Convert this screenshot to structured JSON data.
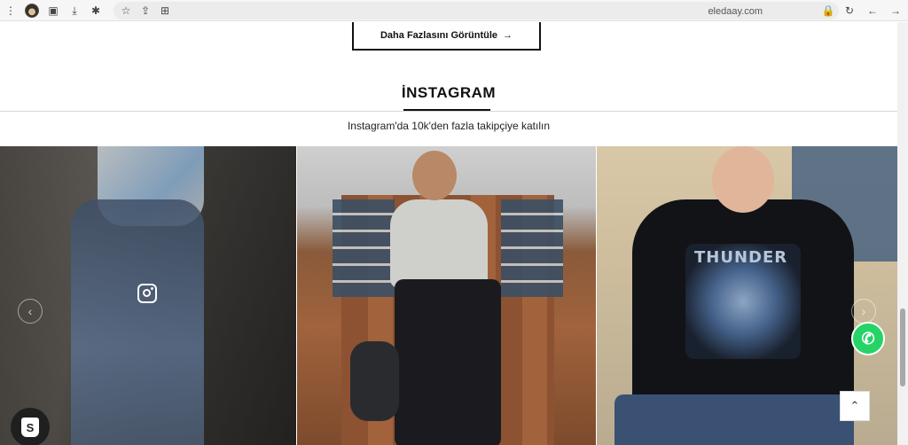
{
  "browser": {
    "url": "eledaay.com",
    "icons": [
      "menu-dots-icon",
      "avatar",
      "sidebar-icon",
      "download-icon",
      "extensions-icon",
      "star-icon",
      "share-icon",
      "translate-icon",
      "lock-icon",
      "reload-icon",
      "back-icon",
      "forward-icon"
    ]
  },
  "page": {
    "more_button": {
      "label": "Daha Fazlasını Görüntüle",
      "arrow": "→"
    },
    "instagram": {
      "title": "İNSTAGRAM",
      "subtitle": "Instagram'da 10k'den fazla takipçiye katılın",
      "tile3_print": "THUNDER"
    },
    "floating": {
      "to_top_glyph": "⌃",
      "whatsapp_glyph": "✆",
      "shopify_glyph": "S",
      "prev_glyph": "‹",
      "next_glyph": "›"
    }
  },
  "colors": {
    "whatsapp": "#25d366",
    "accent": "#111111"
  }
}
